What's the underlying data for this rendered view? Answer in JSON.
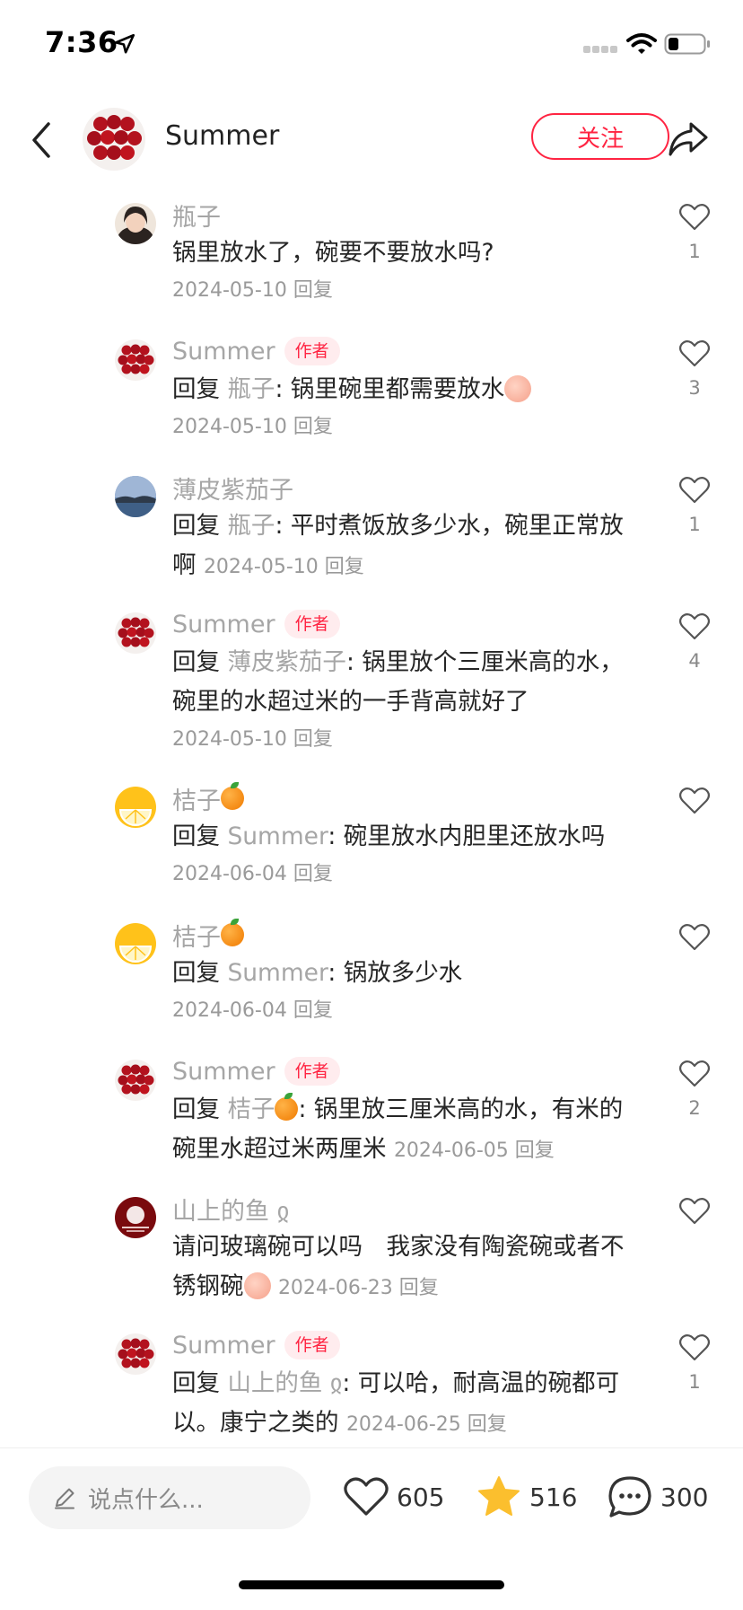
{
  "status": {
    "time": "7:36"
  },
  "header": {
    "name": "Summer",
    "follow_label": "关注"
  },
  "author_tag": "作者",
  "comments": [
    {
      "name": "瓶子",
      "avatar": "woman",
      "is_author": false,
      "prefix": "",
      "ref": "",
      "text": "锅里放水了，碗要不要放水吗?",
      "date": "2024-05-10",
      "reply": "回复",
      "likes": "1",
      "inline_meta": false,
      "name_emoji": false,
      "ref_emoji": false,
      "text_emoji": ""
    },
    {
      "name": "Summer",
      "avatar": "berries",
      "is_author": true,
      "prefix": "回复 ",
      "ref": "瓶子",
      "text": ": 锅里碗里都需要放水",
      "date": "2024-05-10",
      "reply": "回复",
      "likes": "3",
      "inline_meta": false,
      "name_emoji": false,
      "ref_emoji": false,
      "text_emoji": "face"
    },
    {
      "name": "薄皮紫茄子",
      "avatar": "sea",
      "is_author": false,
      "prefix": "回复 ",
      "ref": "瓶子",
      "text": ": 平时煮饭放多少水，碗里正常放啊",
      "date": "2024-05-10",
      "reply": "回复",
      "likes": "1",
      "inline_meta": true,
      "name_emoji": false,
      "ref_emoji": false,
      "text_emoji": ""
    },
    {
      "name": "Summer",
      "avatar": "berries",
      "is_author": true,
      "prefix": "回复 ",
      "ref": "薄皮紫茄子",
      "text": ": 锅里放个三厘米高的水，碗里的水超过米的一手背高就好了",
      "date": "2024-05-10",
      "reply": "回复",
      "likes": "4",
      "inline_meta": false,
      "name_emoji": false,
      "ref_emoji": false,
      "text_emoji": ""
    },
    {
      "name": "桔子",
      "avatar": "lemon",
      "is_author": false,
      "prefix": "回复 ",
      "ref": "Summer",
      "text": ": 碗里放水内胆里还放水吗",
      "date": "2024-06-04",
      "reply": "回复",
      "likes": "",
      "inline_meta": false,
      "name_emoji": true,
      "ref_emoji": false,
      "text_emoji": ""
    },
    {
      "name": "桔子",
      "avatar": "lemon",
      "is_author": false,
      "prefix": "回复 ",
      "ref": "Summer",
      "text": ": 锅放多少水",
      "date": "2024-06-04",
      "reply": "回复",
      "likes": "",
      "inline_meta": false,
      "name_emoji": true,
      "ref_emoji": false,
      "text_emoji": ""
    },
    {
      "name": "Summer",
      "avatar": "berries",
      "is_author": true,
      "prefix": "回复 ",
      "ref": "桔子",
      "text": ": 锅里放三厘米高的水，有米的碗里水超过米两厘米",
      "date": "2024-06-05",
      "reply": "回复",
      "likes": "2",
      "inline_meta": true,
      "name_emoji": false,
      "ref_emoji": true,
      "text_emoji": ""
    },
    {
      "name": "山上的鱼 ჲ",
      "avatar": "moon",
      "is_author": false,
      "prefix": "",
      "ref": "",
      "text": "请问玻璃碗可以吗　我家没有陶瓷碗或者不锈钢碗",
      "date": "2024-06-23",
      "reply": "回复",
      "likes": "",
      "inline_meta": true,
      "name_emoji": false,
      "ref_emoji": false,
      "text_emoji": "face"
    },
    {
      "name": "Summer",
      "avatar": "berries",
      "is_author": true,
      "prefix": "回复 ",
      "ref": "山上的鱼 ჲ",
      "text": ": 可以哈，耐高温的碗都可以。康宁之类的",
      "date": "2024-06-25",
      "reply": "回复",
      "likes": "1",
      "inline_meta": true,
      "name_emoji": false,
      "ref_emoji": false,
      "text_emoji": ""
    }
  ],
  "bottom": {
    "input_placeholder": "说点什么...",
    "likes": "605",
    "stars": "516",
    "comments": "300"
  }
}
